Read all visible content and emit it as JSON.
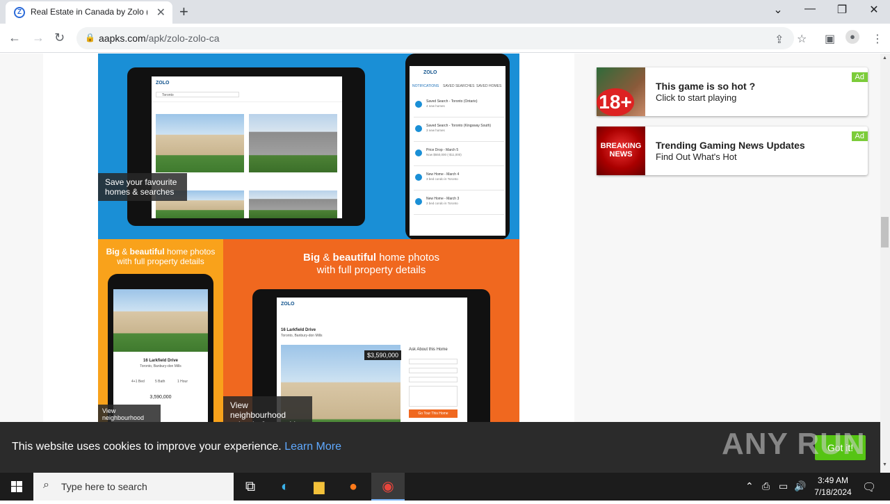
{
  "browser": {
    "tab_title": "Real Estate in Canada by Zolo (c",
    "tab_favicon": "Z",
    "url_domain": "aapks.com",
    "url_path": "/apk/zolo-zolo-ca",
    "new_tab": "+",
    "minimize": "—",
    "restore": "❐",
    "close": "✕",
    "dropdown": "⌄"
  },
  "screenshots": {
    "shot1_caption": "Save your favourite homes & searches",
    "shot2_headline_bold": "Big",
    "shot2_headline_amp": " & ",
    "shot2_headline_bold2": "beautiful",
    "shot2_headline_rest": " home photos with full property details",
    "shot2_caption": "View neighbourhood schools & amenities",
    "shot3_headline_bold": "Big",
    "shot3_headline_amp": " & ",
    "shot3_headline_bold2": "beautiful",
    "shot3_headline_rest": " home photos",
    "shot3_headline_line2": "with full property details",
    "shot3_caption": "View neighbourhood schools & amenities",
    "zolo_logo": "ZOLO",
    "tablet_search": "Toronto",
    "phone_tabs": [
      "NOTIFICATIONS",
      "SAVED SEARCHES",
      "SAVED HOMES"
    ],
    "notifications": [
      {
        "title": "Saved Search - Toronto (Ontario)",
        "sub": "4 new homes"
      },
      {
        "title": "Saved Search - Toronto (Kingsway South)",
        "sub": "3 new homes"
      },
      {
        "title": "Price Drop - March 5",
        "sub": "Now $550,000 (-$11,000)"
      },
      {
        "title": "New Home - March 4",
        "sub": "3 bed condo in Toronto"
      },
      {
        "title": "New Home - March 3",
        "sub": "2 bed condo in Toronto"
      }
    ],
    "listing_address": "16 Larkfield Drive",
    "listing_area": "Toronto, Banbury-don Mills",
    "listing_price": "3,590,000",
    "listing_price_label": "$3,590,000",
    "ask_title": "Ask About this Home",
    "tour_button": "Go Tour This Home",
    "phone_beds": "4+1 Bed",
    "phone_baths": "5 Bath",
    "phone_hour": "1 Hour"
  },
  "ads": [
    {
      "headline": "This game is so hot ?",
      "sub": "Click to start playing",
      "badge": "Ad",
      "image_text": "18+"
    },
    {
      "headline": "Trending Gaming News Updates",
      "sub": "Find Out What's Hot",
      "badge": "Ad",
      "image_text": "BREAKING NEWS"
    }
  ],
  "cookie": {
    "message": "This website uses cookies to improve your experience.",
    "link": "Learn More",
    "button": "Got it!"
  },
  "watermark": "ANY RUN",
  "taskbar": {
    "search_placeholder": "Type here to search",
    "time": "3:49 AM",
    "date": "7/18/2024"
  }
}
